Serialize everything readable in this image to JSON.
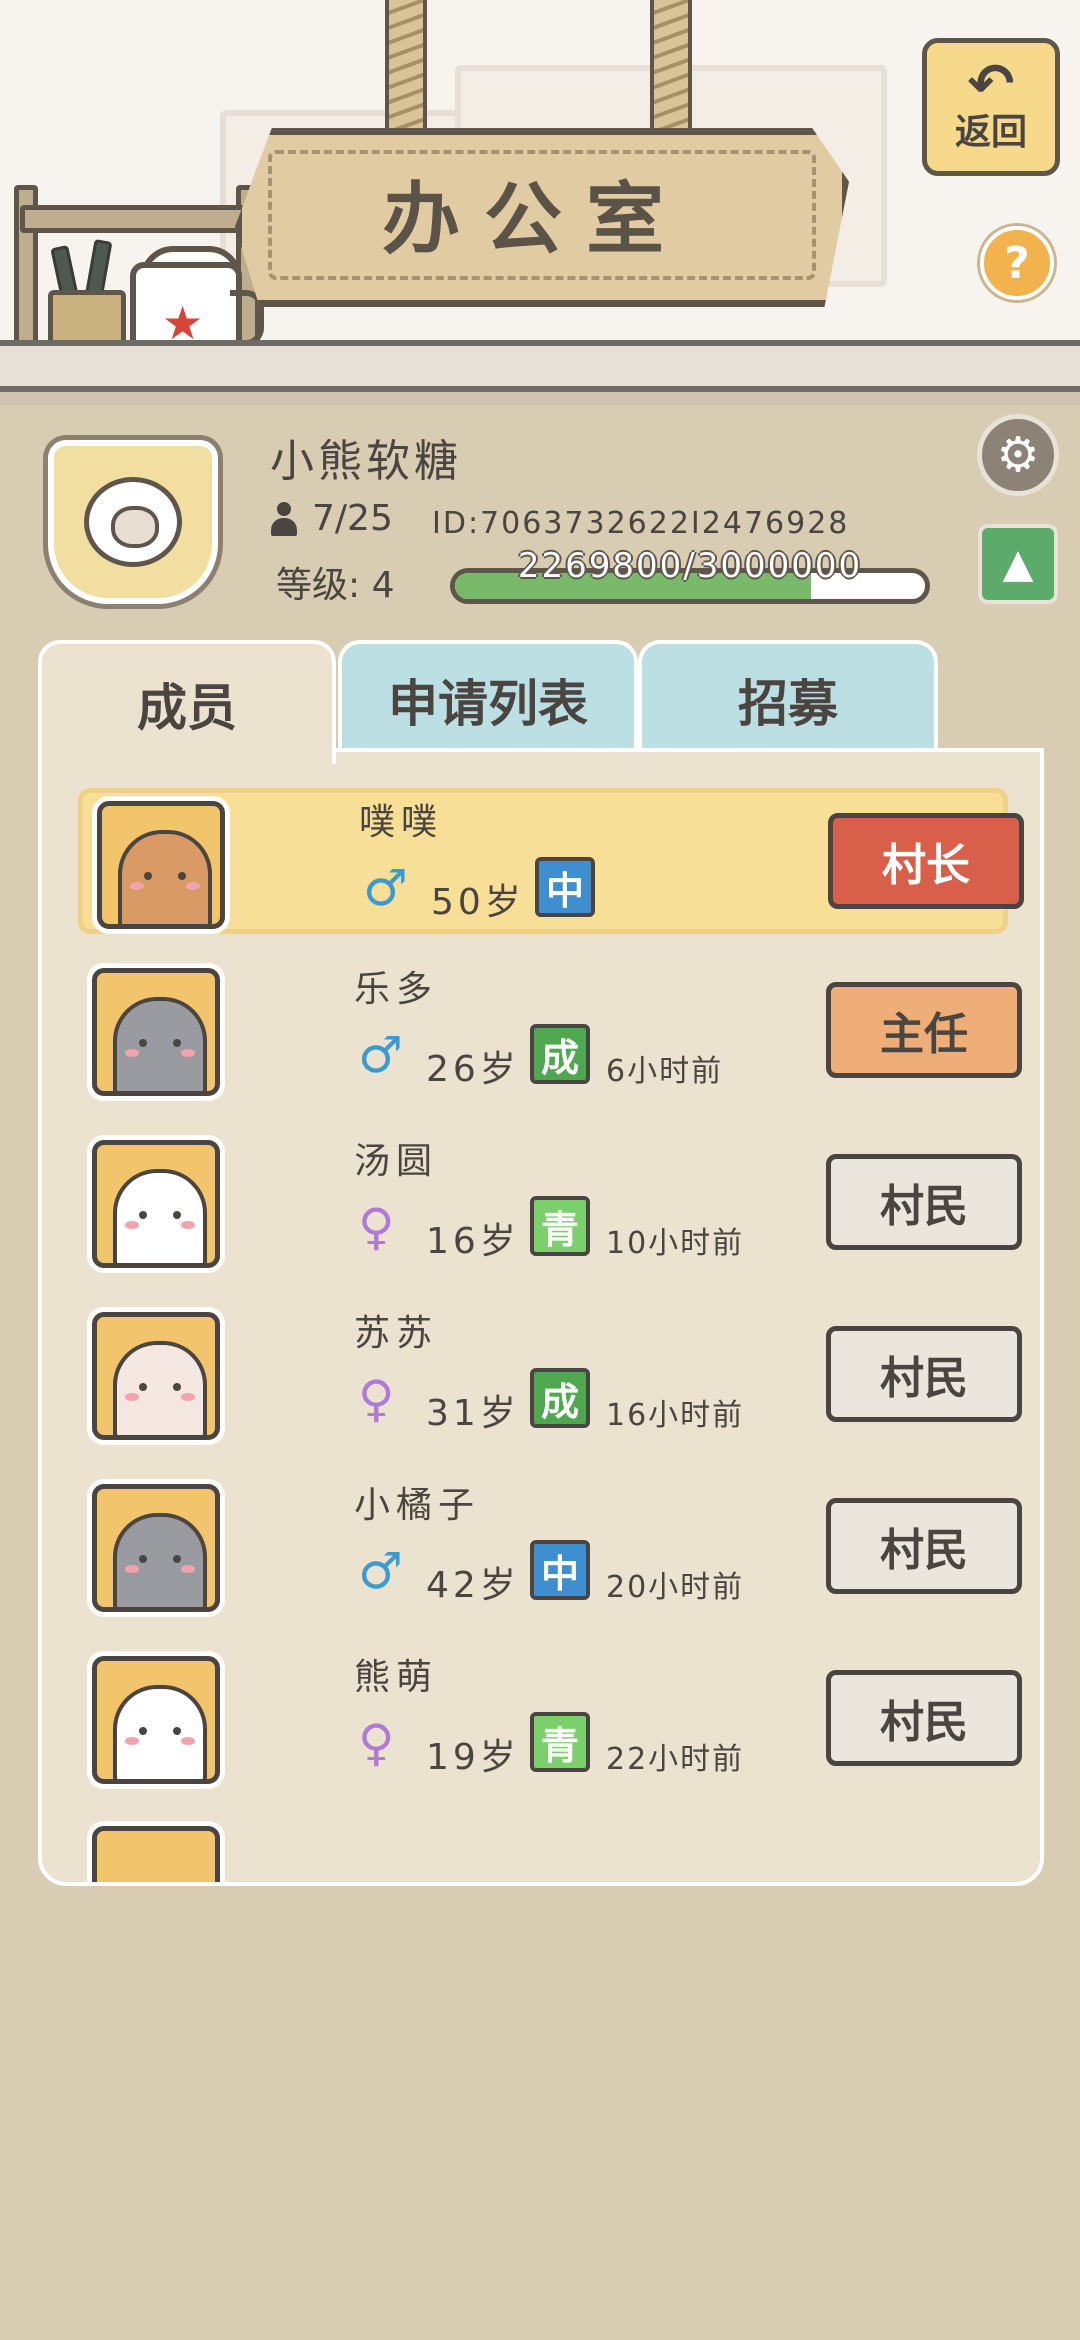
{
  "header": {
    "title": "办公室",
    "back_label": "返回",
    "back_icon": "↶",
    "help_label": "?"
  },
  "profile": {
    "village_name": "小熊软糖",
    "member_count": "7/25",
    "id_text": "ID:7063732622I2476928",
    "level_text": "等级: 4",
    "exp_text": "2269800/3000000",
    "exp_progress": 0.7566
  },
  "tabs": [
    {
      "label": "成员",
      "active": true
    },
    {
      "label": "申请列表",
      "active": false
    },
    {
      "label": "招募",
      "active": false
    }
  ],
  "members": [
    {
      "name": "噗噗",
      "sex": "♂",
      "gender": "male",
      "age": "50岁",
      "stage": "中",
      "stage_color": "#3f8fd0",
      "last_seen": "",
      "role": "村长",
      "role_bg": "#d8604a",
      "role_color": "#ffffff",
      "animal": "bear",
      "face_color": "#d99a65",
      "leader": true
    },
    {
      "name": "乐多",
      "sex": "♂",
      "gender": "male",
      "age": "26岁",
      "stage": "成",
      "stage_color": "#4fa84f",
      "last_seen": "6小时前",
      "role": "主任",
      "role_bg": "#efae77",
      "role_color": "#4a4540",
      "animal": "penguin",
      "face_color": "#9a9ba0",
      "leader": false
    },
    {
      "name": "汤圆",
      "sex": "♀",
      "gender": "female",
      "age": "16岁",
      "stage": "青",
      "stage_color": "#7bd06c",
      "last_seen": "10小时前",
      "role": "村民",
      "role_bg": "#ebe6dd",
      "role_color": "#4a4540",
      "animal": "panda",
      "face_color": "#ffffff",
      "leader": false
    },
    {
      "name": "苏苏",
      "sex": "♀",
      "gender": "female",
      "age": "31岁",
      "stage": "成",
      "stage_color": "#4fa84f",
      "last_seen": "16小时前",
      "role": "村民",
      "role_bg": "#ebe6dd",
      "role_color": "#4a4540",
      "animal": "hedgehog",
      "face_color": "#f4e6e0",
      "leader": false
    },
    {
      "name": "小橘子",
      "sex": "♂",
      "gender": "male",
      "age": "42岁",
      "stage": "中",
      "stage_color": "#3f8fd0",
      "last_seen": "20小时前",
      "role": "村民",
      "role_bg": "#ebe6dd",
      "role_color": "#4a4540",
      "animal": "penguin",
      "face_color": "#9a9ba0",
      "leader": false
    },
    {
      "name": "熊萌",
      "sex": "♀",
      "gender": "female",
      "age": "19岁",
      "stage": "青",
      "stage_color": "#7bd06c",
      "last_seen": "22小时前",
      "role": "村民",
      "role_bg": "#ebe6dd",
      "role_color": "#4a4540",
      "animal": "panda",
      "face_color": "#ffffff",
      "leader": false
    }
  ]
}
